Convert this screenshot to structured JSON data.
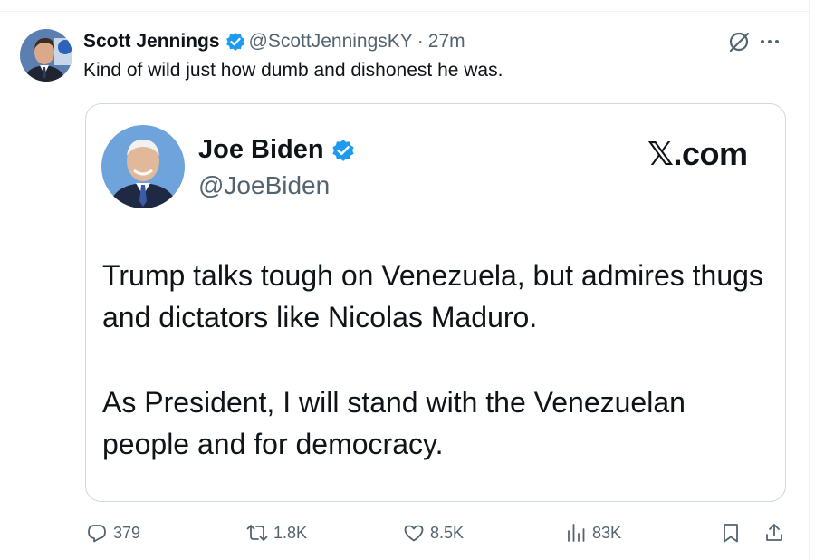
{
  "post": {
    "author_name": "Scott Jennings",
    "handle": "@ScottJenningsKY",
    "separator": "·",
    "time": "27m",
    "text": "Kind of wild just how dumb and dishonest he was."
  },
  "quoted": {
    "author_name": "Joe Biden",
    "handle": "@JoeBiden",
    "brand": "𝕏.com",
    "paragraph_1": "Trump talks tough on Venezuela, but admires thugs and dictators like Nicolas Maduro.",
    "paragraph_2": "As President, I will stand with the Venezuelan people and for democracy."
  },
  "actions": {
    "replies": "379",
    "reposts": "1.8K",
    "likes": "8.5K",
    "views": "83K"
  },
  "colors": {
    "verified_blue": "#1d9bf0",
    "text_primary": "#0f1419",
    "text_secondary": "#536471",
    "border": "#cfd9de"
  },
  "icons": [
    "verified-badge-icon",
    "grok-icon",
    "more-icon",
    "reply-icon",
    "repost-icon",
    "like-icon",
    "views-icon",
    "bookmark-icon",
    "share-icon"
  ]
}
